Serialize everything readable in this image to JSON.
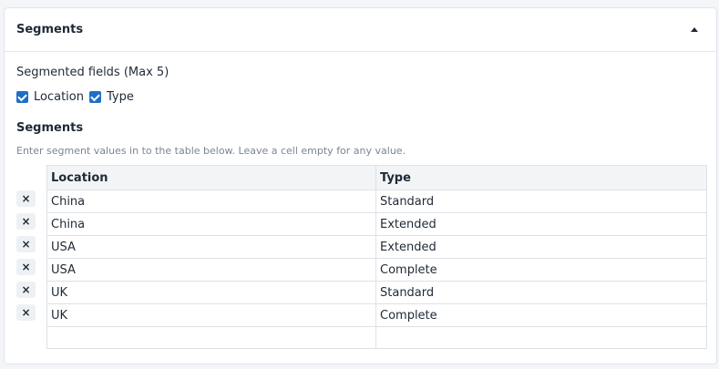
{
  "panel": {
    "title": "Segments",
    "collapse_icon": "caret-up-icon"
  },
  "segmented_fields": {
    "label": "Segmented fields (Max 5)",
    "options": [
      {
        "label": "Location",
        "checked": true
      },
      {
        "label": "Type",
        "checked": true
      }
    ]
  },
  "segments": {
    "label": "Segments",
    "help": "Enter segment values in to the table below. Leave a cell empty for any value.",
    "columns": [
      "Location",
      "Type"
    ],
    "rows": [
      [
        "China",
        "Standard"
      ],
      [
        "China",
        "Extended"
      ],
      [
        "USA",
        "Extended"
      ],
      [
        "USA",
        "Complete"
      ],
      [
        "UK",
        "Standard"
      ],
      [
        "UK",
        "Complete"
      ]
    ],
    "remove_icon": "close-icon",
    "remove_symbol": "×"
  },
  "colors": {
    "accent": "#1f6fc5",
    "header_bg": "#f3f4f6",
    "border": "#dde1e6"
  }
}
